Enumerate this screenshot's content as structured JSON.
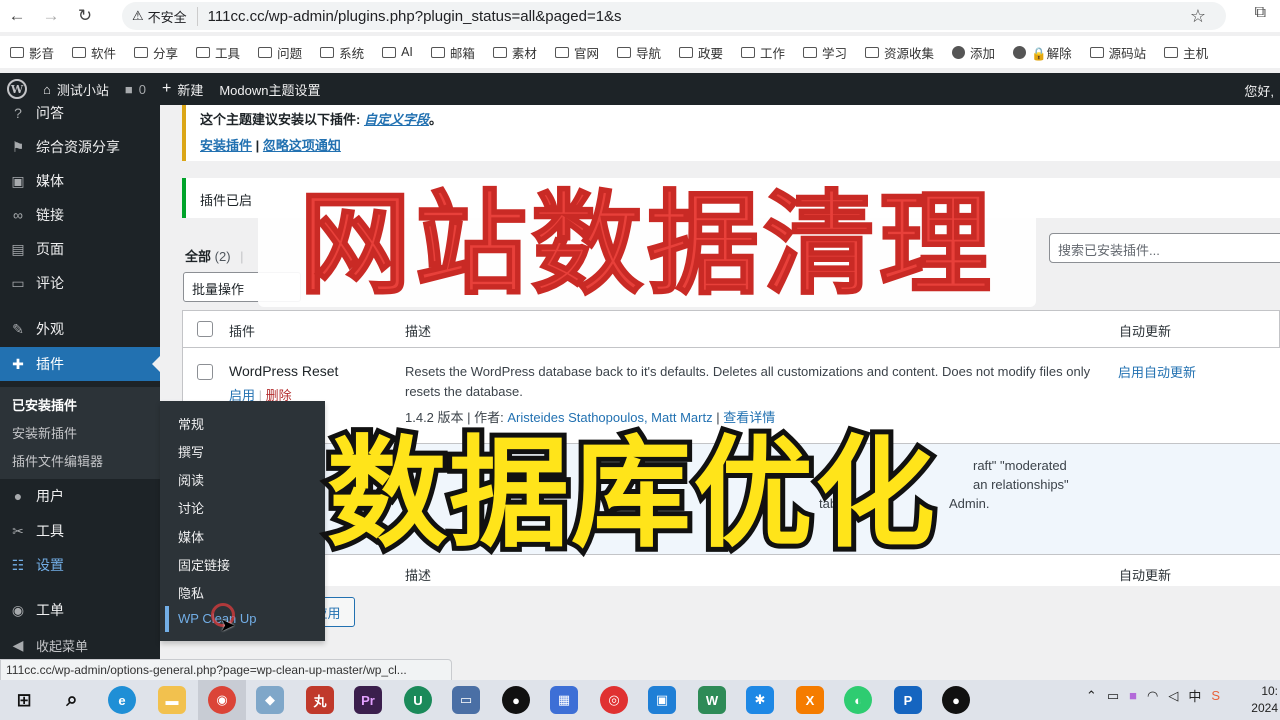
{
  "browser": {
    "insecure_label": "不安全",
    "url": "111cc.cc/wp-admin/plugins.php?plugin_status=all&paged=1&s",
    "status_url": "111cc.cc/wp-admin/options-general.php?page=wp-clean-up-master/wp_cl..."
  },
  "bookmarks": [
    "影音",
    "软件",
    "分享",
    "工具",
    "问题",
    "系统",
    "AI",
    "邮箱",
    "素材",
    "官网",
    "导航",
    "政要",
    "工作",
    "学习",
    "资源收集",
    "添加",
    "🔒解除",
    "源码站",
    "主机"
  ],
  "adminbar": {
    "site_name": "测试小站",
    "comments_count": "0",
    "new_label": "新建",
    "theme_settings": "Modown主题设置",
    "greeting": "您好,"
  },
  "sidebar": {
    "items": [
      {
        "label": "问答",
        "icon": "question-icon"
      },
      {
        "label": "综合资源分享",
        "icon": "flag-icon"
      },
      {
        "label": "媒体",
        "icon": "media-icon"
      },
      {
        "label": "链接",
        "icon": "link-icon"
      },
      {
        "label": "页面",
        "icon": "page-icon"
      },
      {
        "label": "评论",
        "icon": "comment-icon"
      },
      {
        "label": "外观",
        "icon": "brush-icon"
      },
      {
        "label": "插件",
        "icon": "plugin-icon"
      },
      {
        "label": "用户",
        "icon": "user-icon"
      },
      {
        "label": "工具",
        "icon": "wrench-icon"
      },
      {
        "label": "设置",
        "icon": "settings-icon"
      },
      {
        "label": "工单",
        "icon": "ticket-icon"
      },
      {
        "label": "收起菜单",
        "icon": "collapse-icon"
      }
    ],
    "plugin_submenu": [
      "已安装插件",
      "安装新插件",
      "插件文件编辑器"
    ]
  },
  "flyout": [
    "常规",
    "撰写",
    "阅读",
    "讨论",
    "媒体",
    "固定链接",
    "隐私",
    "WP Clean Up"
  ],
  "notices": {
    "tgm_text": "这个主题建议安装以下插件:",
    "tgm_plugin": "自定义字段",
    "tgm_period": "。",
    "install_link": "安装插件",
    "separator": "|",
    "dismiss_link": "忽略这项通知",
    "activated_text": "插件已启"
  },
  "filters": {
    "all_label": "全部",
    "all_count": "(2)",
    "pipe": "|"
  },
  "search_placeholder": "搜索已安装插件...",
  "bulk_label": "批量操作",
  "apply_label": "应用",
  "table": {
    "col_plugin": "插件",
    "col_desc": "描述",
    "col_auto": "自动更新",
    "row1": {
      "name": "WordPress Reset",
      "action_enable": "启用",
      "action_sep": "|",
      "action_delete": "删除",
      "description_l1": "Resets the WordPress database back to it's defaults. Deletes all customizations and content. Does not modify files only",
      "description_l2": "resets the database.",
      "version": "1.4.2 版本 | 作者:",
      "authors": "Aristeides Stathopoulos, Matt Martz",
      "details": "查看详情",
      "auto_update": "启用自动更新"
    },
    "row2": {
      "desc_fragment_1": "raft\" \"moderated",
      "desc_fragment_2": "an relationships\"",
      "desc_fragment_3": "tab",
      "desc_fragment_4": "Admin."
    }
  },
  "overlay": {
    "title_top": "网站数据清理",
    "title_bottom": "数据库优化"
  },
  "taskbar": {
    "tray_lang": "中",
    "clock_time": "10:",
    "clock_year": "2024"
  }
}
